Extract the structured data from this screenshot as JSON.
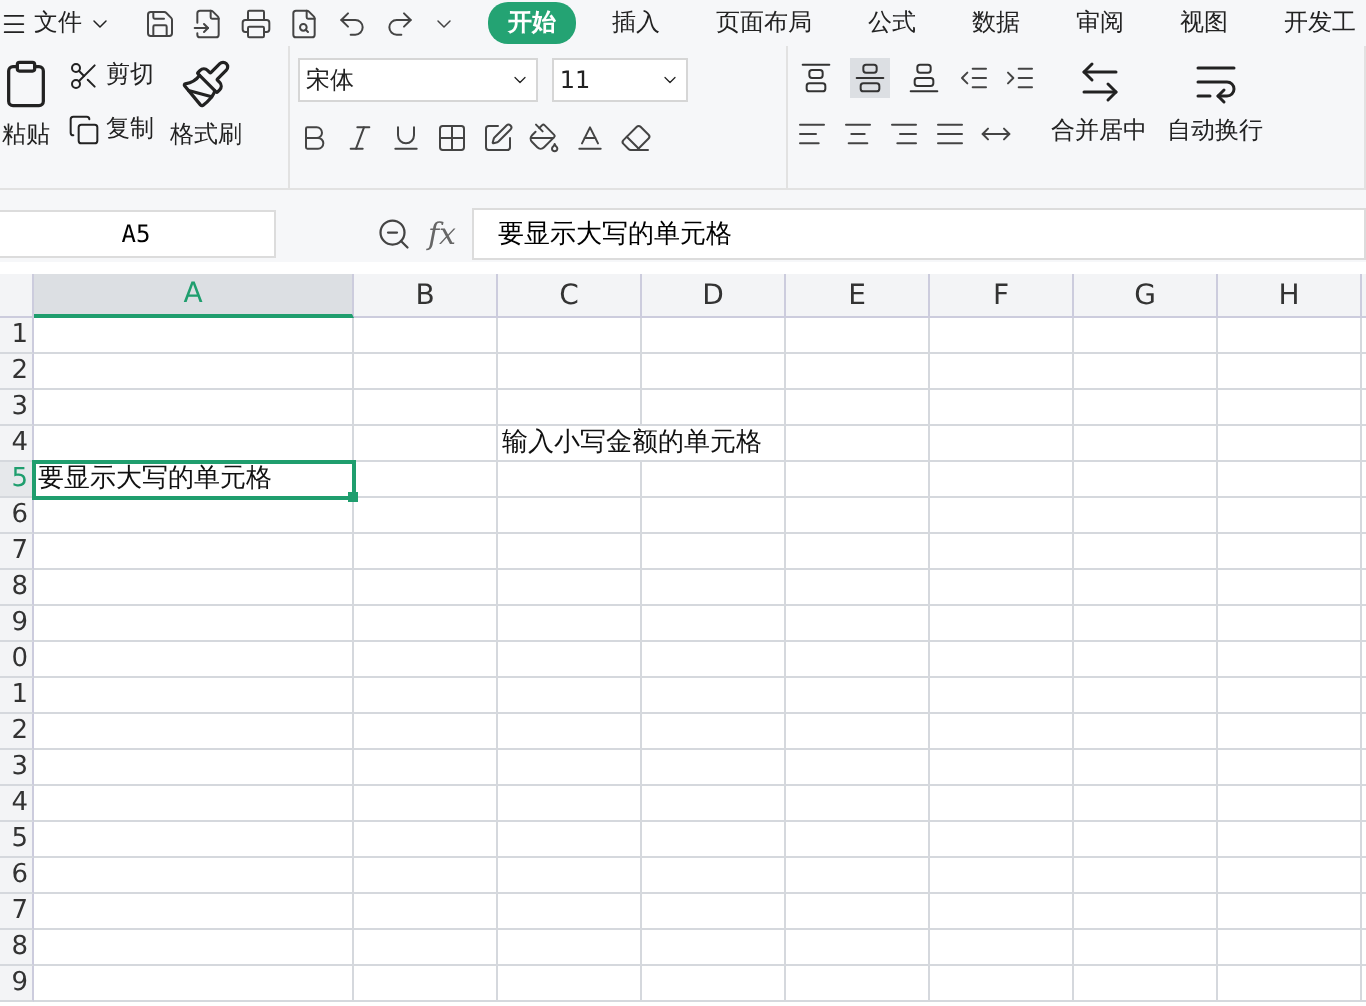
{
  "menu": {
    "file_label": "文件",
    "tabs": [
      {
        "label": "开始",
        "selected": true
      },
      {
        "label": "插入",
        "selected": false
      },
      {
        "label": "页面布局",
        "selected": false
      },
      {
        "label": "公式",
        "selected": false
      },
      {
        "label": "数据",
        "selected": false
      },
      {
        "label": "审阅",
        "selected": false
      },
      {
        "label": "视图",
        "selected": false
      },
      {
        "label": "开发工",
        "selected": false
      }
    ]
  },
  "ribbon": {
    "paste": "粘贴",
    "cut": "剪切",
    "copy": "复制",
    "format_painter": "格式刷",
    "font_name": "宋体",
    "font_size": "11",
    "vertical_align": [
      {
        "kind": "top",
        "selected": false
      },
      {
        "kind": "middle",
        "selected": true
      },
      {
        "kind": "bottom",
        "selected": false
      }
    ],
    "merge": "合并居中",
    "wrap": "自动换行"
  },
  "formula_bar": {
    "name_box": "A5",
    "fx_label": "fx",
    "formula": "要显示大写的单元格"
  },
  "sheet": {
    "columns": [
      {
        "label": "A",
        "selected": true
      },
      {
        "label": "B",
        "selected": false
      },
      {
        "label": "C",
        "selected": false
      },
      {
        "label": "D",
        "selected": false
      },
      {
        "label": "E",
        "selected": false
      },
      {
        "label": "F",
        "selected": false
      },
      {
        "label": "G",
        "selected": false
      },
      {
        "label": "H",
        "selected": false
      }
    ],
    "rows": [
      {
        "label": "1",
        "selected": false,
        "cells": []
      },
      {
        "label": "2",
        "selected": false,
        "cells": []
      },
      {
        "label": "3",
        "selected": false,
        "cells": []
      },
      {
        "label": "4",
        "selected": false,
        "cells": [
          "",
          "",
          "输入小写金额的单元格"
        ]
      },
      {
        "label": "5",
        "selected": true,
        "cells": [
          "要显示大写的单元格"
        ]
      },
      {
        "label": "6",
        "selected": false,
        "cells": []
      },
      {
        "label": "7",
        "selected": false,
        "cells": []
      },
      {
        "label": "8",
        "selected": false,
        "cells": []
      },
      {
        "label": "9",
        "selected": false,
        "cells": []
      },
      {
        "label": "0",
        "selected": false,
        "cells": []
      },
      {
        "label": "1",
        "selected": false,
        "cells": []
      },
      {
        "label": "2",
        "selected": false,
        "cells": []
      },
      {
        "label": "3",
        "selected": false,
        "cells": []
      },
      {
        "label": "4",
        "selected": false,
        "cells": []
      },
      {
        "label": "5",
        "selected": false,
        "cells": []
      },
      {
        "label": "6",
        "selected": false,
        "cells": []
      },
      {
        "label": "7",
        "selected": false,
        "cells": []
      },
      {
        "label": "8",
        "selected": false,
        "cells": []
      },
      {
        "label": "9",
        "selected": false,
        "cells": []
      }
    ]
  }
}
